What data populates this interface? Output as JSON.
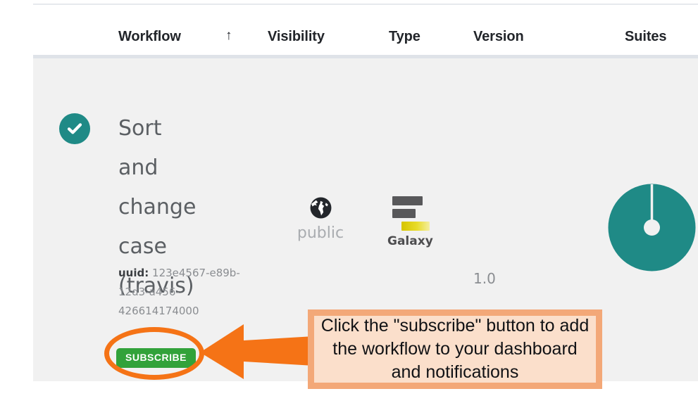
{
  "table": {
    "columns": [
      {
        "key": "workflow",
        "label": "Workflow"
      },
      {
        "key": "visibility",
        "label": "Visibility"
      },
      {
        "key": "type",
        "label": "Type"
      },
      {
        "key": "version",
        "label": "Version"
      },
      {
        "key": "suites",
        "label": "Suites"
      }
    ],
    "sort": {
      "column": "Workflow",
      "direction": "ascending",
      "glyph": "↑"
    },
    "rows": [
      {
        "status": {
          "icon": "check-circle-icon",
          "state": "ok",
          "color": "#1f8a86"
        },
        "workflow_name": "Sort and change case (travis)",
        "uuid_label": "uuid:",
        "uuid_value": "123e4567-e89b-12d3-a456-426614174000",
        "subscribe_label": "SUBSCRIBE",
        "visibility": {
          "icon": "globe-icon",
          "label": "public"
        },
        "type": {
          "icon": "galaxy-logo-icon",
          "label": "Galaxy"
        },
        "version": "1.0",
        "suites": {
          "icon": "pie-chart-icon",
          "percent": 100,
          "color": "#1f8a86"
        }
      }
    ]
  },
  "annotation": {
    "highlight_shape": "ellipse",
    "arrow_direction": "left",
    "accent_color": "#f57316",
    "box_fill": "#fbdfcb",
    "box_border": "#f3a878",
    "text": "Click the \"subscribe\" button to add the workflow to your dashboard and notifications"
  },
  "colors": {
    "teal": "#1f8a86",
    "green_button": "#32a23a",
    "row_background": "#f1f1f1",
    "header_background": "#ffffff",
    "divider": "#dfe3e8"
  }
}
